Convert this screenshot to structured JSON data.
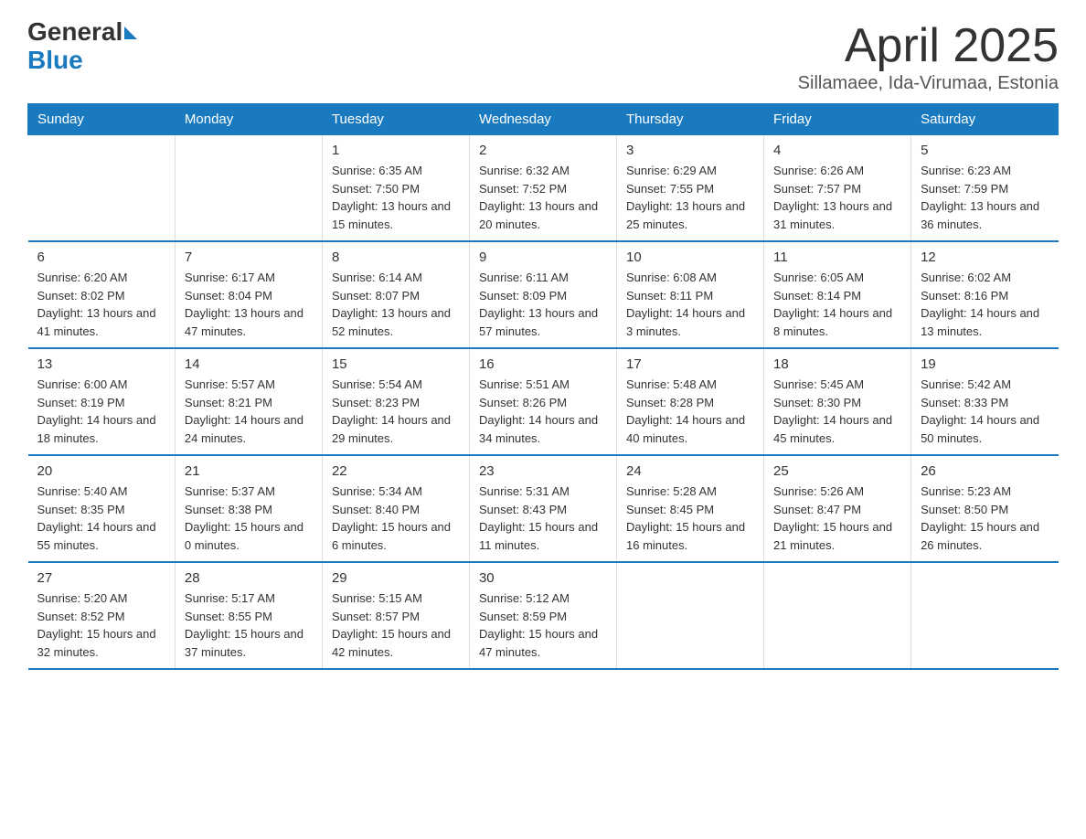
{
  "header": {
    "logo_general": "General",
    "logo_blue": "Blue",
    "title": "April 2025",
    "location": "Sillamaee, Ida-Virumaa, Estonia"
  },
  "days_of_week": [
    "Sunday",
    "Monday",
    "Tuesday",
    "Wednesday",
    "Thursday",
    "Friday",
    "Saturday"
  ],
  "weeks": [
    [
      {
        "day": "",
        "sunrise": "",
        "sunset": "",
        "daylight": ""
      },
      {
        "day": "",
        "sunrise": "",
        "sunset": "",
        "daylight": ""
      },
      {
        "day": "1",
        "sunrise": "Sunrise: 6:35 AM",
        "sunset": "Sunset: 7:50 PM",
        "daylight": "Daylight: 13 hours and 15 minutes."
      },
      {
        "day": "2",
        "sunrise": "Sunrise: 6:32 AM",
        "sunset": "Sunset: 7:52 PM",
        "daylight": "Daylight: 13 hours and 20 minutes."
      },
      {
        "day": "3",
        "sunrise": "Sunrise: 6:29 AM",
        "sunset": "Sunset: 7:55 PM",
        "daylight": "Daylight: 13 hours and 25 minutes."
      },
      {
        "day": "4",
        "sunrise": "Sunrise: 6:26 AM",
        "sunset": "Sunset: 7:57 PM",
        "daylight": "Daylight: 13 hours and 31 minutes."
      },
      {
        "day": "5",
        "sunrise": "Sunrise: 6:23 AM",
        "sunset": "Sunset: 7:59 PM",
        "daylight": "Daylight: 13 hours and 36 minutes."
      }
    ],
    [
      {
        "day": "6",
        "sunrise": "Sunrise: 6:20 AM",
        "sunset": "Sunset: 8:02 PM",
        "daylight": "Daylight: 13 hours and 41 minutes."
      },
      {
        "day": "7",
        "sunrise": "Sunrise: 6:17 AM",
        "sunset": "Sunset: 8:04 PM",
        "daylight": "Daylight: 13 hours and 47 minutes."
      },
      {
        "day": "8",
        "sunrise": "Sunrise: 6:14 AM",
        "sunset": "Sunset: 8:07 PM",
        "daylight": "Daylight: 13 hours and 52 minutes."
      },
      {
        "day": "9",
        "sunrise": "Sunrise: 6:11 AM",
        "sunset": "Sunset: 8:09 PM",
        "daylight": "Daylight: 13 hours and 57 minutes."
      },
      {
        "day": "10",
        "sunrise": "Sunrise: 6:08 AM",
        "sunset": "Sunset: 8:11 PM",
        "daylight": "Daylight: 14 hours and 3 minutes."
      },
      {
        "day": "11",
        "sunrise": "Sunrise: 6:05 AM",
        "sunset": "Sunset: 8:14 PM",
        "daylight": "Daylight: 14 hours and 8 minutes."
      },
      {
        "day": "12",
        "sunrise": "Sunrise: 6:02 AM",
        "sunset": "Sunset: 8:16 PM",
        "daylight": "Daylight: 14 hours and 13 minutes."
      }
    ],
    [
      {
        "day": "13",
        "sunrise": "Sunrise: 6:00 AM",
        "sunset": "Sunset: 8:19 PM",
        "daylight": "Daylight: 14 hours and 18 minutes."
      },
      {
        "day": "14",
        "sunrise": "Sunrise: 5:57 AM",
        "sunset": "Sunset: 8:21 PM",
        "daylight": "Daylight: 14 hours and 24 minutes."
      },
      {
        "day": "15",
        "sunrise": "Sunrise: 5:54 AM",
        "sunset": "Sunset: 8:23 PM",
        "daylight": "Daylight: 14 hours and 29 minutes."
      },
      {
        "day": "16",
        "sunrise": "Sunrise: 5:51 AM",
        "sunset": "Sunset: 8:26 PM",
        "daylight": "Daylight: 14 hours and 34 minutes."
      },
      {
        "day": "17",
        "sunrise": "Sunrise: 5:48 AM",
        "sunset": "Sunset: 8:28 PM",
        "daylight": "Daylight: 14 hours and 40 minutes."
      },
      {
        "day": "18",
        "sunrise": "Sunrise: 5:45 AM",
        "sunset": "Sunset: 8:30 PM",
        "daylight": "Daylight: 14 hours and 45 minutes."
      },
      {
        "day": "19",
        "sunrise": "Sunrise: 5:42 AM",
        "sunset": "Sunset: 8:33 PM",
        "daylight": "Daylight: 14 hours and 50 minutes."
      }
    ],
    [
      {
        "day": "20",
        "sunrise": "Sunrise: 5:40 AM",
        "sunset": "Sunset: 8:35 PM",
        "daylight": "Daylight: 14 hours and 55 minutes."
      },
      {
        "day": "21",
        "sunrise": "Sunrise: 5:37 AM",
        "sunset": "Sunset: 8:38 PM",
        "daylight": "Daylight: 15 hours and 0 minutes."
      },
      {
        "day": "22",
        "sunrise": "Sunrise: 5:34 AM",
        "sunset": "Sunset: 8:40 PM",
        "daylight": "Daylight: 15 hours and 6 minutes."
      },
      {
        "day": "23",
        "sunrise": "Sunrise: 5:31 AM",
        "sunset": "Sunset: 8:43 PM",
        "daylight": "Daylight: 15 hours and 11 minutes."
      },
      {
        "day": "24",
        "sunrise": "Sunrise: 5:28 AM",
        "sunset": "Sunset: 8:45 PM",
        "daylight": "Daylight: 15 hours and 16 minutes."
      },
      {
        "day": "25",
        "sunrise": "Sunrise: 5:26 AM",
        "sunset": "Sunset: 8:47 PM",
        "daylight": "Daylight: 15 hours and 21 minutes."
      },
      {
        "day": "26",
        "sunrise": "Sunrise: 5:23 AM",
        "sunset": "Sunset: 8:50 PM",
        "daylight": "Daylight: 15 hours and 26 minutes."
      }
    ],
    [
      {
        "day": "27",
        "sunrise": "Sunrise: 5:20 AM",
        "sunset": "Sunset: 8:52 PM",
        "daylight": "Daylight: 15 hours and 32 minutes."
      },
      {
        "day": "28",
        "sunrise": "Sunrise: 5:17 AM",
        "sunset": "Sunset: 8:55 PM",
        "daylight": "Daylight: 15 hours and 37 minutes."
      },
      {
        "day": "29",
        "sunrise": "Sunrise: 5:15 AM",
        "sunset": "Sunset: 8:57 PM",
        "daylight": "Daylight: 15 hours and 42 minutes."
      },
      {
        "day": "30",
        "sunrise": "Sunrise: 5:12 AM",
        "sunset": "Sunset: 8:59 PM",
        "daylight": "Daylight: 15 hours and 47 minutes."
      },
      {
        "day": "",
        "sunrise": "",
        "sunset": "",
        "daylight": ""
      },
      {
        "day": "",
        "sunrise": "",
        "sunset": "",
        "daylight": ""
      },
      {
        "day": "",
        "sunrise": "",
        "sunset": "",
        "daylight": ""
      }
    ]
  ]
}
